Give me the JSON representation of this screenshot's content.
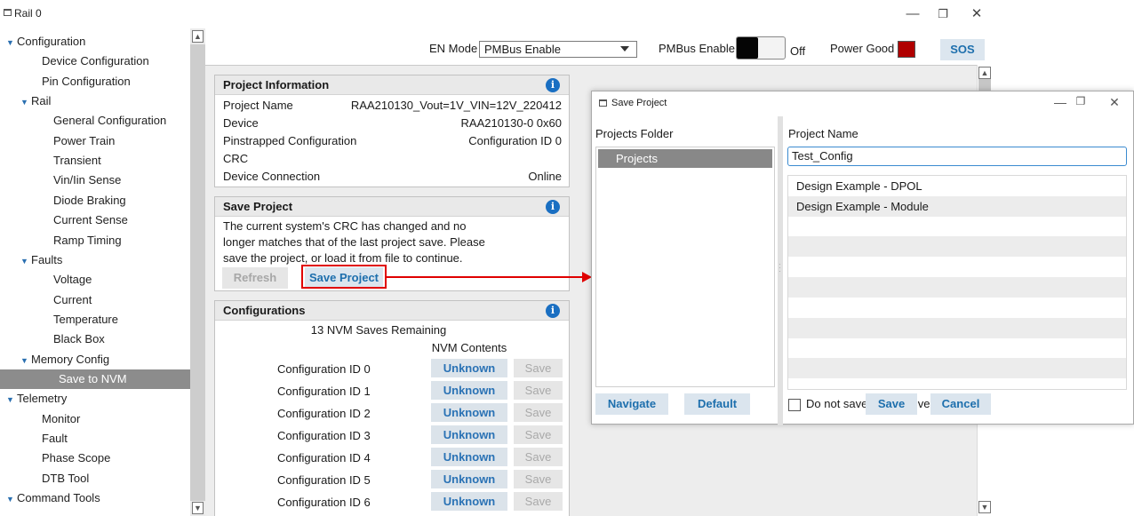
{
  "window": {
    "title": "Rail 0",
    "minimize": "—",
    "maximize": "❐",
    "close": "✕"
  },
  "tree": {
    "items": [
      {
        "label": "Configuration",
        "expandable": true,
        "selected": false
      },
      {
        "label": "Device Configuration",
        "expandable": false,
        "selected": false
      },
      {
        "label": "Pin Configuration",
        "expandable": false,
        "selected": false
      },
      {
        "label": "Rail",
        "expandable": true,
        "selected": false
      },
      {
        "label": "General Configuration",
        "expandable": false,
        "selected": false
      },
      {
        "label": "Power Train",
        "expandable": false,
        "selected": false
      },
      {
        "label": "Transient",
        "expandable": false,
        "selected": false
      },
      {
        "label": "Vin/Iin Sense",
        "expandable": false,
        "selected": false
      },
      {
        "label": "Diode Braking",
        "expandable": false,
        "selected": false
      },
      {
        "label": "Current Sense",
        "expandable": false,
        "selected": false
      },
      {
        "label": "Ramp Timing",
        "expandable": false,
        "selected": false
      },
      {
        "label": "Faults",
        "expandable": true,
        "selected": false
      },
      {
        "label": "Voltage",
        "expandable": false,
        "selected": false
      },
      {
        "label": "Current",
        "expandable": false,
        "selected": false
      },
      {
        "label": "Temperature",
        "expandable": false,
        "selected": false
      },
      {
        "label": "Black Box",
        "expandable": false,
        "selected": false
      },
      {
        "label": "Memory Config",
        "expandable": true,
        "selected": false
      },
      {
        "label": "Save to NVM",
        "expandable": false,
        "selected": true
      },
      {
        "label": "Telemetry",
        "expandable": true,
        "selected": false
      },
      {
        "label": "Monitor",
        "expandable": false,
        "selected": false
      },
      {
        "label": "Fault",
        "expandable": false,
        "selected": false
      },
      {
        "label": "Phase Scope",
        "expandable": false,
        "selected": false
      },
      {
        "label": "DTB Tool",
        "expandable": false,
        "selected": false
      },
      {
        "label": "Command Tools",
        "expandable": true,
        "selected": false
      }
    ]
  },
  "toolbar": {
    "en_mode_label": "EN Mode",
    "en_mode_value": "PMBus Enable",
    "pmbus_enable_label": "PMBus Enable",
    "pmbus_enable_state": "Off",
    "power_good_label": "Power Good",
    "power_good_color": "#b00000",
    "sos_label": "SOS"
  },
  "project_info": {
    "header": "Project Information",
    "rows": [
      {
        "label": "Project Name",
        "value": "RAA210130_Vout=1V_VIN=12V_220412"
      },
      {
        "label": "Device",
        "value": "RAA210130-0 0x60"
      },
      {
        "label": "Pinstrapped Configuration",
        "value": "Configuration ID 0"
      },
      {
        "label": "CRC",
        "value": ""
      },
      {
        "label": "Device Connection",
        "value": "Online"
      }
    ]
  },
  "save_project": {
    "header": "Save Project",
    "message": "The current system's CRC has changed and no longer matches that of the last project save. Please save the project, or load it from file to continue.",
    "refresh_label": "Refresh",
    "save_label": "Save Project"
  },
  "configurations": {
    "header": "Configurations",
    "remaining": "13 NVM Saves Remaining",
    "contents_header": "NVM Contents",
    "rows": [
      {
        "name": "Configuration ID 0",
        "status": "Unknown",
        "save": "Save"
      },
      {
        "name": "Configuration ID 1",
        "status": "Unknown",
        "save": "Save"
      },
      {
        "name": "Configuration ID 2",
        "status": "Unknown",
        "save": "Save"
      },
      {
        "name": "Configuration ID 3",
        "status": "Unknown",
        "save": "Save"
      },
      {
        "name": "Configuration ID 4",
        "status": "Unknown",
        "save": "Save"
      },
      {
        "name": "Configuration ID 5",
        "status": "Unknown",
        "save": "Save"
      },
      {
        "name": "Configuration ID 6",
        "status": "Unknown",
        "save": "Save"
      }
    ]
  },
  "dialog": {
    "title": "Save Project",
    "folder_label": "Projects Folder",
    "folder_items": [
      "Projects"
    ],
    "navigate_label": "Navigate",
    "default_label": "Default",
    "project_name_label": "Project Name",
    "project_name_value": "Test_Config",
    "projects": [
      "Design Example - DPOL",
      "Design Example - Module"
    ],
    "do_not_save_label": "Do not save perspective",
    "save_label": "Save",
    "cancel_label": "Cancel"
  },
  "icons": {
    "info": "info-icon",
    "expand": "triangle-down-icon",
    "scroll_up": "scroll-up-arrow-icon",
    "scroll_down": "scroll-down-arrow-icon"
  }
}
